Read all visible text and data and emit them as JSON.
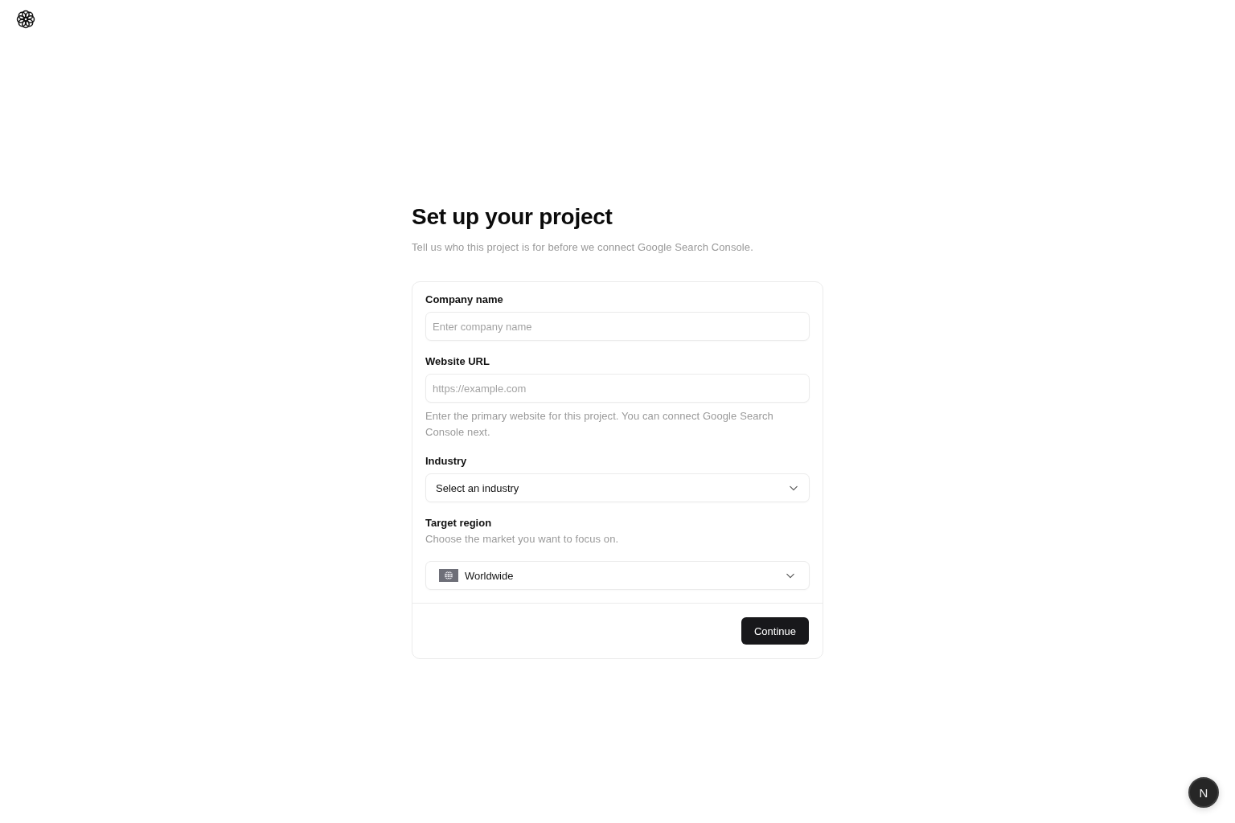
{
  "page": {
    "title": "Set up your project",
    "subtitle": "Tell us who this project is for before we connect Google Search Console."
  },
  "form": {
    "fields": [
      {
        "kind": "text",
        "label": "Company name",
        "placeholder": "Enter company name"
      },
      {
        "kind": "text",
        "label": "Website URL",
        "placeholder": "https://example.com",
        "help": "Enter the primary website for this project. You can connect Google Search Console next."
      },
      {
        "kind": "select",
        "label": "Industry",
        "value": "Select an industry"
      },
      {
        "kind": "region-select",
        "label": "Target region",
        "description": "Choose the market you want to focus on.",
        "value": "Worldwide"
      }
    ],
    "submit_button": {
      "label": "Continue"
    }
  },
  "dev_indicator": {
    "label": "N"
  }
}
